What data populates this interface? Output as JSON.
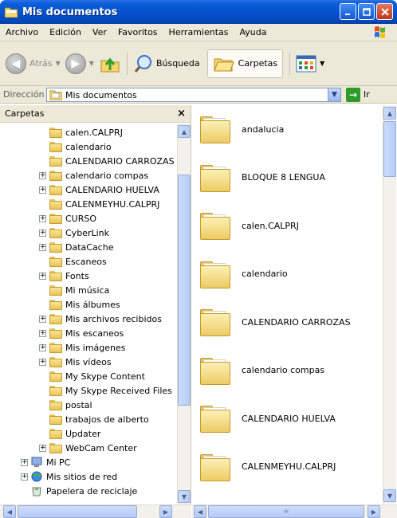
{
  "window": {
    "title": "Mis documentos",
    "colors": {
      "titlebar": "#0553cf",
      "chrome": "#ece9d8",
      "folder": "#f4d77a"
    }
  },
  "menu": [
    "Archivo",
    "Edición",
    "Ver",
    "Favoritos",
    "Herramientas",
    "Ayuda"
  ],
  "toolbar": {
    "back_label": "Atrás",
    "search_label": "Búsqueda",
    "folders_label": "Carpetas"
  },
  "address": {
    "label": "Dirección",
    "value": "Mis documentos",
    "go_label": "Ir"
  },
  "folder_pane": {
    "title": "Carpetas",
    "close_glyph": "×",
    "items": [
      {
        "label": "calen.CALPRJ",
        "expandable": false
      },
      {
        "label": "calendario",
        "expandable": false
      },
      {
        "label": "CALENDARIO CARROZAS",
        "expandable": false
      },
      {
        "label": "calendario compas",
        "expandable": true
      },
      {
        "label": "CALENDARIO HUELVA",
        "expandable": true
      },
      {
        "label": "CALENMEYHU.CALPRJ",
        "expandable": false
      },
      {
        "label": "CURSO",
        "expandable": true
      },
      {
        "label": "CyberLink",
        "expandable": true
      },
      {
        "label": "DataCache",
        "expandable": true
      },
      {
        "label": "Escaneos",
        "expandable": false
      },
      {
        "label": "Fonts",
        "expandable": true
      },
      {
        "label": "Mi música",
        "expandable": false
      },
      {
        "label": "Mis álbumes",
        "expandable": false
      },
      {
        "label": "Mis archivos recibidos",
        "expandable": true
      },
      {
        "label": "Mis escaneos",
        "expandable": true
      },
      {
        "label": "Mis imágenes",
        "expandable": true
      },
      {
        "label": "Mis vídeos",
        "expandable": true
      },
      {
        "label": "My Skype Content",
        "expandable": false
      },
      {
        "label": "My Skype Received Files",
        "expandable": false
      },
      {
        "label": "postal",
        "expandable": false
      },
      {
        "label": "trabajos de alberto",
        "expandable": false
      },
      {
        "label": "Updater",
        "expandable": false
      },
      {
        "label": "WebCam Center",
        "expandable": true
      }
    ],
    "root_items": [
      {
        "label": "Mi PC",
        "expandable": true
      },
      {
        "label": "Mis sitios de red",
        "expandable": true
      },
      {
        "label": "Papelera de reciclaje",
        "expandable": false
      }
    ]
  },
  "content": {
    "items": [
      "andalucia",
      "BLOQUE 8 LENGUA",
      "calen.CALPRJ",
      "calendario",
      "CALENDARIO CARROZAS",
      "calendario compas",
      "CALENDARIO HUELVA",
      "CALENMEYHU.CALPRJ"
    ]
  },
  "scroll_glyphs": {
    "up": "▲",
    "down": "▼",
    "left": "◀",
    "right": "▶",
    "grip": "≡"
  }
}
